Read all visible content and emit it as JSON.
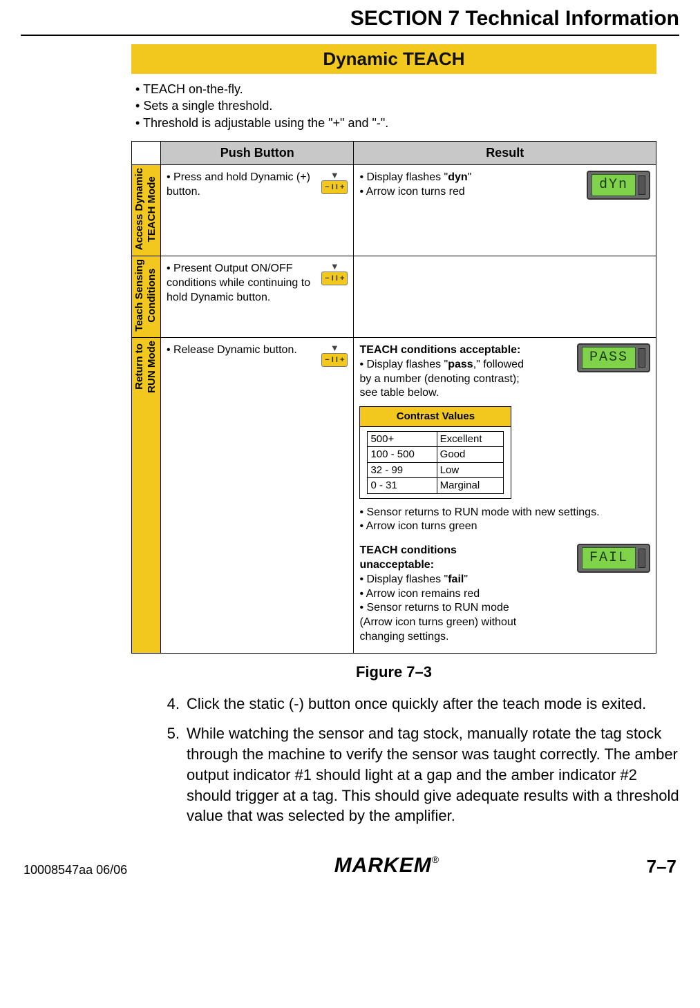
{
  "header": {
    "title": "SECTION 7 Technical Information"
  },
  "figure": {
    "banner": "Dynamic TEACH",
    "intro": [
      "TEACH on-the-fly.",
      "Sets a single threshold.",
      "Threshold is adjustable using the \"+\" and \"-\"."
    ],
    "columns": {
      "push_button": "Push Button",
      "result": "Result"
    },
    "rows": [
      {
        "label": "Access Dynamic\nTEACH Mode",
        "push_button": "Press and hold Dynamic (+) button.",
        "button_icon": "− I I +",
        "result_lines": [
          "Display flashes \"dyn\"",
          "Arrow icon turns red"
        ],
        "display": "dYn"
      },
      {
        "label": "Teach Sensing\nConditions",
        "push_button": "Present Output ON/OFF conditions while continuing to hold Dynamic button.",
        "button_icon": "− I I +",
        "result_lines": [],
        "display": ""
      },
      {
        "label": "Return to\nRUN Mode",
        "push_button": "Release Dynamic button.",
        "button_icon": "− I I +",
        "acceptable": {
          "title": "TEACH conditions acceptable:",
          "lines": [
            "Display flashes \"pass,\" followed by a number (denoting contrast); see table below."
          ],
          "display": "PASS"
        },
        "contrast": {
          "title": "Contrast Values",
          "rows": [
            {
              "range": "500+",
              "rating": "Excellent"
            },
            {
              "range": "100 - 500",
              "rating": "Good"
            },
            {
              "range": "32 - 99",
              "rating": "Low"
            },
            {
              "range": "0 - 31",
              "rating": "Marginal"
            }
          ]
        },
        "after_contrast": [
          "Sensor returns to RUN mode with new settings.",
          "Arrow icon turns green"
        ],
        "unacceptable": {
          "title": "TEACH conditions unacceptable:",
          "lines": [
            "Display flashes \"fail\"",
            "Arrow icon remains red",
            "Sensor returns to RUN mode (Arrow icon turns green) without changing settings."
          ],
          "display": "FAIL"
        }
      }
    ],
    "caption": "Figure 7–3"
  },
  "steps": [
    {
      "num": "4.",
      "text": "Click the static (-) button once quickly after the teach mode is exited."
    },
    {
      "num": "5.",
      "text": "While watching the sensor and tag stock, manually rotate the tag stock through the machine to verify the sensor was taught correctly. The amber output indicator #1 should light at a gap and the amber indicator #2 should trigger at a tag. This should give adequate results with a threshold value that was selected by the amplifier."
    }
  ],
  "footer": {
    "left": "10008547aa 06/06",
    "center": "MARKEM",
    "reg": "®",
    "right": "7–7"
  }
}
